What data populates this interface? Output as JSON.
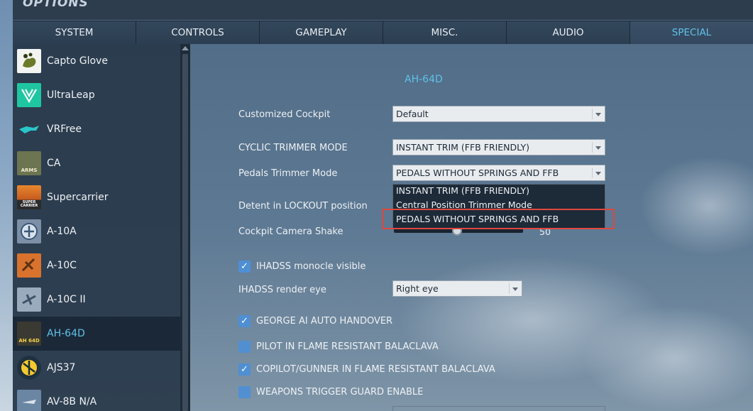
{
  "window": {
    "title": "OPTIONS"
  },
  "tabs": [
    {
      "label": "SYSTEM",
      "active": false
    },
    {
      "label": "CONTROLS",
      "active": false
    },
    {
      "label": "GAMEPLAY",
      "active": false
    },
    {
      "label": "MISC.",
      "active": false
    },
    {
      "label": "AUDIO",
      "active": false
    },
    {
      "label": "SPECIAL",
      "active": true
    }
  ],
  "sidebar": {
    "items": [
      {
        "label": "Capto Glove",
        "icon": "capto-glove-icon"
      },
      {
        "label": "UltraLeap",
        "icon": "ultraleap-icon"
      },
      {
        "label": "VRFree",
        "icon": "vrfree-icon"
      },
      {
        "label": "CA",
        "icon": "ca-icon",
        "badge": "ARMS"
      },
      {
        "label": "Supercarrier",
        "icon": "supercarrier-icon",
        "badge": "SUPER CARRIER"
      },
      {
        "label": "A-10A",
        "icon": "a10a-icon"
      },
      {
        "label": "A-10C",
        "icon": "a10c-icon"
      },
      {
        "label": "A-10C II",
        "icon": "a10c-ii-icon"
      },
      {
        "label": "AH-64D",
        "icon": "ah64d-icon",
        "badge": "AH 64D",
        "active": true
      },
      {
        "label": "AJS37",
        "icon": "ajs37-icon"
      },
      {
        "label": "AV-8B N/A",
        "icon": "av8b-icon"
      }
    ]
  },
  "main": {
    "module_title": "AH-64D",
    "settings": {
      "customized_cockpit": {
        "label": "Customized Cockpit",
        "value": "Default"
      },
      "cyclic_trimmer": {
        "label": "CYCLIC TRIMMER MODE",
        "value": "INSTANT TRIM (FFB FRIENDLY)"
      },
      "pedals_trimmer": {
        "label": "Pedals Trimmer Mode",
        "value": "PEDALS WITHOUT SPRINGS AND FFB",
        "options": [
          "INSTANT TRIM (FFB FRIENDLY)",
          "Central Position Trimmer Mode",
          "PEDALS WITHOUT SPRINGS AND FFB"
        ]
      },
      "detent_lockout": {
        "label": "Detent in LOCKOUT position"
      },
      "camera_shake": {
        "label": "Cockpit Camera Shake",
        "value": "50",
        "level": 0.5
      },
      "ihadss_visible": {
        "label": "IHADSS monocle visible",
        "checked": true
      },
      "ihadss_eye": {
        "label": "IHADSS render eye",
        "value": "Right eye"
      },
      "george_handover": {
        "label": "GEORGE AI AUTO HANDOVER",
        "checked": true
      },
      "pilot_balaclava": {
        "label": "PILOT IN FLAME RESISTANT BALACLAVA",
        "checked": false
      },
      "cpg_balaclava": {
        "label": "COPILOT/GUNNER IN FLAME RESISTANT BALACLAVA",
        "checked": true
      },
      "trigger_guard": {
        "label": "WEAPONS TRIGGER GUARD ENABLE",
        "checked": false
      }
    },
    "check_glyph": "✓"
  },
  "colors": {
    "accent": "#5ec2e8",
    "highlight": "#e0483f",
    "checkbox": "#4f8fd4",
    "tab_bar": "#2c3e51",
    "sidebar": "#28384a"
  }
}
